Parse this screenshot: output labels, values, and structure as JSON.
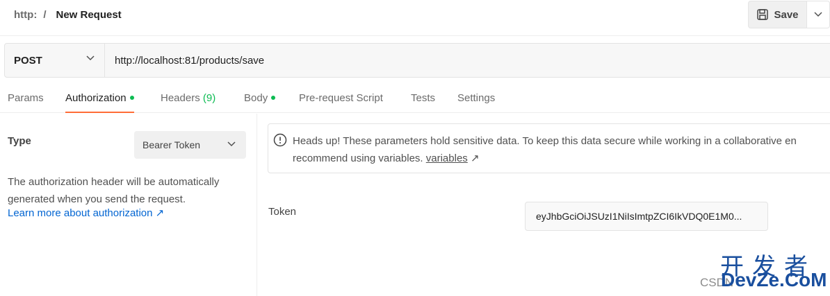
{
  "header": {
    "breadcrumb_parent": "http:",
    "breadcrumb_separator": "/",
    "title": "New Request",
    "save_label": "Save"
  },
  "request": {
    "method": "POST",
    "url": "http://localhost:81/products/save"
  },
  "tabs": [
    {
      "label": "Params",
      "active": false
    },
    {
      "label": "Authorization",
      "active": true,
      "dot": true
    },
    {
      "label": "Headers",
      "count": "(9)",
      "active": false
    },
    {
      "label": "Body",
      "active": false,
      "dot": true
    },
    {
      "label": "Pre-request Script",
      "active": false
    },
    {
      "label": "Tests",
      "active": false
    },
    {
      "label": "Settings",
      "active": false
    }
  ],
  "auth": {
    "type_label": "Type",
    "type_value": "Bearer Token",
    "description": "The authorization header will be automatically generated when you send the request.",
    "learn_link": "Learn more about authorization ↗",
    "alert_line1": "Heads up! These parameters hold sensitive data. To keep this data secure while working in a collaborative en",
    "alert_line2": "recommend using variables.",
    "alert_link": "variables",
    "alert_link_arrow": "↗",
    "token_label": "Token",
    "token_value": "eyJhbGciOiJSUzI1NiIsImtpZCI6IkVDQ0E1M0..."
  },
  "watermark": {
    "cn": "开发者",
    "csdn": "CSDN",
    "en": "DevZe.CoM"
  },
  "colors": {
    "accent": "#ff6c37",
    "status_green": "#0cbb52",
    "link_blue": "#0265d2"
  },
  "icons": {
    "save": "floppy-disk-icon",
    "dropdown": "chevron-down-icon",
    "alert": "info-circle-icon"
  }
}
